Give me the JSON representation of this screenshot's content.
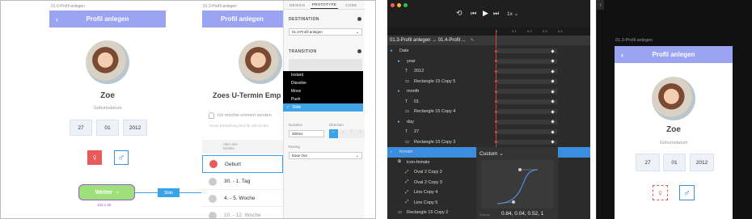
{
  "left": {
    "frame1_label": "01.0-Profil anlegen",
    "frame2_label": "01.3-Profil anlegen",
    "title": "Profil anlegen",
    "name": "Zoe",
    "birthdate_label": "Geburtsdatum",
    "day": "27",
    "month": "01",
    "year": "2012",
    "female_symbol": "♀",
    "male_symbol": "♂",
    "next_button": "Weiter",
    "size_label": "163 x 45",
    "slide_badge": "Slide",
    "frame2_heading": "Zoes U-Termin Emp",
    "reminder_text": "Ich möchte erinnert werden",
    "hint_text": "Diese Einstellung wird für alle Kinder",
    "table_col1": "Alter des Kindes",
    "list_items": [
      "Geburt",
      "30. - 1. Tag",
      "4. - 5. Woche",
      "10. - 12. Woche"
    ]
  },
  "inspector": {
    "tabs": [
      "DESIGN",
      "PROTOTYPE",
      "CODE"
    ],
    "destination_title": "DESTINATION",
    "destination_value": "01.3-Profil anlegen",
    "transition_title": "TRANSITION",
    "options": [
      "Instant",
      "Dissolve",
      "Move",
      "Push",
      "Slide"
    ],
    "selected_option": "Slide",
    "duration_label": "Duration",
    "duration_value": "300ms",
    "direction_label": "Direction",
    "easing_label": "Easing",
    "easing_value": "Ease Out"
  },
  "timeline": {
    "speed": "1x",
    "path": "01.3-Profil anlegen → 01.4-Profil ...",
    "ticks": [
      "0",
      "0.1",
      "0.2",
      "0.3",
      "0.4"
    ],
    "rows": [
      {
        "label": "Date",
        "indent": 0,
        "type": "folder"
      },
      {
        "label": "year",
        "indent": 1,
        "type": "folder"
      },
      {
        "label": "2012",
        "indent": 2,
        "type": "text"
      },
      {
        "label": "Rectangle 15 Copy 5",
        "indent": 2,
        "type": "rect"
      },
      {
        "label": "month",
        "indent": 1,
        "type": "folder"
      },
      {
        "label": "01",
        "indent": 2,
        "type": "text"
      },
      {
        "label": "Rectangle 15 Copy 4",
        "indent": 2,
        "type": "rect"
      },
      {
        "label": "day",
        "indent": 1,
        "type": "folder"
      },
      {
        "label": "27",
        "indent": 2,
        "type": "text"
      },
      {
        "label": "Rectangle 15 Copy 3",
        "indent": 2,
        "type": "rect"
      },
      {
        "label": "female",
        "indent": 0,
        "type": "folder"
      },
      {
        "label": "icon-female",
        "indent": 1,
        "type": "group"
      },
      {
        "label": "Oval 2 Copy 2",
        "indent": 2,
        "type": "path"
      },
      {
        "label": "Oval 2 Copy 3",
        "indent": 2,
        "type": "path"
      },
      {
        "label": "Line Copy 4",
        "indent": 2,
        "type": "path"
      },
      {
        "label": "Line Copy 5",
        "indent": 2,
        "type": "path"
      },
      {
        "label": "Rectangle 15 Copy 2",
        "indent": 1,
        "type": "rect"
      }
    ],
    "curve_title": "Custom",
    "curve_values": "0.84, 0.04, 0.52, 1",
    "curve_source_label": "Source"
  },
  "preview": {
    "frame_label": "01.3-Profil anlegen",
    "title": "Profil anlegen",
    "name": "Zoe",
    "birthdate_label": "Geburtsdatum",
    "day": "27",
    "month": "01",
    "year": "2012"
  }
}
